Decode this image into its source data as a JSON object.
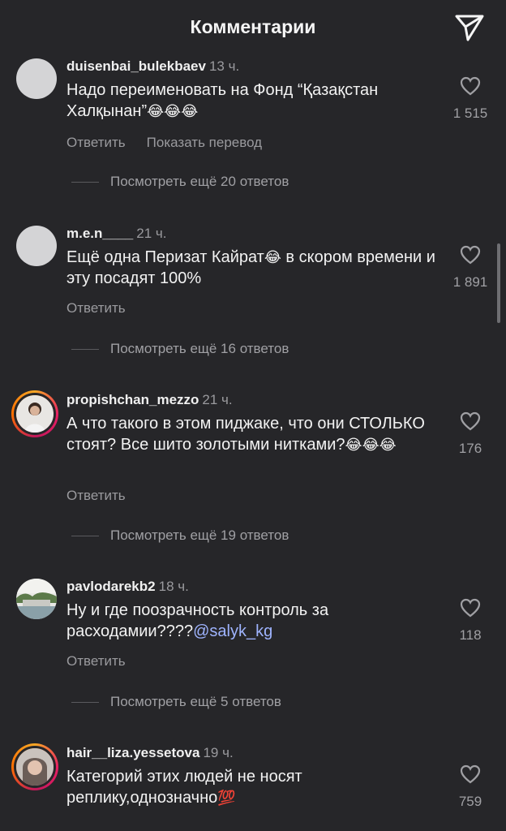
{
  "header": {
    "title": "Комментарии",
    "send_icon": "paper-plane-icon"
  },
  "comments": [
    {
      "author": "duisenbai_bulekbaev",
      "time": "13 ч.",
      "text_a": "Надо переименовать на Фонд “Қазақстан Халқынан”",
      "emoji": "😂😂😂",
      "likes": "1 515",
      "reply": "Ответить",
      "translate": "Показать перевод",
      "view_more": "Посмотреть ещё 20 ответов"
    },
    {
      "author": "m.e.n____",
      "time": "21 ч.",
      "text_a": "Ещё одна Перизат Кайрат",
      "emoji": "😂",
      "text_b": " в скором времени и эту посадят 100%",
      "likes": "1 891",
      "reply": "Ответить",
      "view_more": "Посмотреть ещё 16 ответов"
    },
    {
      "author": "propishchan_mezzo",
      "time": "21 ч.",
      "text_a": "А что такого в этом пиджаке, что они СТОЛЬКО стоят? Все шито золотыми нитками?",
      "emoji": "😂😂😂",
      "likes": "176",
      "reply": "Ответить",
      "view_more": "Посмотреть ещё 19 ответов"
    },
    {
      "author": "pavlodarekb2",
      "time": "18 ч.",
      "text_a": "Ну и где поозрачность контроль  за расходамии????",
      "mention": "@salyk_kg",
      "likes": "118",
      "reply": "Ответить",
      "view_more": "Посмотреть ещё 5 ответов"
    },
    {
      "author": "hair__liza.yessetova",
      "time": "19 ч.",
      "text_a": "Категорий этих людей не носят реплику,однозначно",
      "emoji": "💯",
      "likes": "759"
    }
  ],
  "colors": {
    "background": "#262629",
    "muted": "#9a9a9e",
    "mention": "#9fb4ff"
  }
}
